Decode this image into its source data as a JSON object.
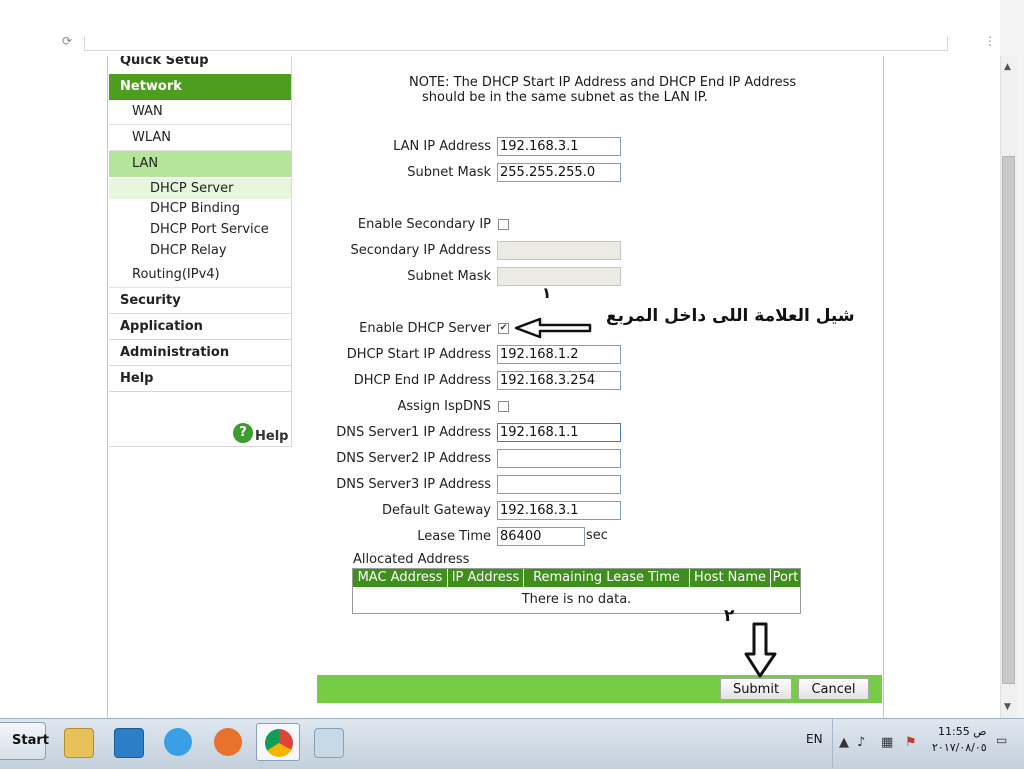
{
  "sidebar": {
    "top_cut": "Quick Setup",
    "network": "Network",
    "wan": "WAN",
    "wlan": "WLAN",
    "lan": "LAN",
    "dhcp_server": "DHCP Server",
    "dhcp_binding": "DHCP Binding",
    "dhcp_port_service": "DHCP Port Service",
    "dhcp_relay": "DHCP Relay",
    "routing": "Routing(IPv4)",
    "security": "Security",
    "application": "Application",
    "administration": "Administration",
    "help": "Help",
    "help_badge": "?",
    "help_link": "Help"
  },
  "note": {
    "line1": "NOTE: The DHCP Start IP Address and DHCP End IP Address",
    "line2": "should be in the same subnet as the LAN IP."
  },
  "form": {
    "lan_ip_label": "LAN IP Address",
    "lan_ip_value": "192.168.3.1",
    "subnet_mask_label": "Subnet Mask",
    "subnet_mask_value": "255.255.255.0",
    "enable_secondary_ip_label": "Enable Secondary IP",
    "secondary_ip_label": "Secondary IP Address",
    "secondary_ip_value": "",
    "secondary_mask_label": "Subnet Mask",
    "secondary_mask_value": "",
    "enable_dhcp_label": "Enable DHCP Server",
    "enable_dhcp_checked": "✔",
    "dhcp_start_label": "DHCP Start IP Address",
    "dhcp_start_value": "192.168.1.2",
    "dhcp_end_label": "DHCP End IP Address",
    "dhcp_end_value": "192.168.3.254",
    "assign_isp_dns_label": "Assign IspDNS",
    "dns1_label": "DNS Server1 IP Address",
    "dns1_value": "192.168.1.1",
    "dns2_label": "DNS Server2 IP Address",
    "dns2_value": "",
    "dns3_label": "DNS Server3 IP Address",
    "dns3_value": "",
    "gateway_label": "Default Gateway",
    "gateway_value": "192.168.3.1",
    "lease_label": "Lease Time",
    "lease_value": "86400",
    "lease_unit": "sec"
  },
  "allocated": {
    "title": "Allocated Address",
    "columns": [
      "MAC Address",
      "IP Address",
      "Remaining Lease Time",
      "Host Name",
      "Port"
    ],
    "empty": "There is no data."
  },
  "buttons": {
    "submit": "Submit",
    "cancel": "Cancel"
  },
  "annotations": {
    "instruction": "شيل العلامة اللى داخل المربع",
    "step_one": "١",
    "step_two": "٢"
  },
  "taskbar": {
    "start": "Start",
    "lang": "EN",
    "clock_time": "11:55 ص",
    "clock_date": "٢٠١٧/٠٨/٠٥"
  },
  "colors": {
    "menu_green": "#4d9e1f",
    "submenu_green": "#b4e59a",
    "table_header": "#3f8f1c",
    "button_bar": "#77cc46"
  }
}
